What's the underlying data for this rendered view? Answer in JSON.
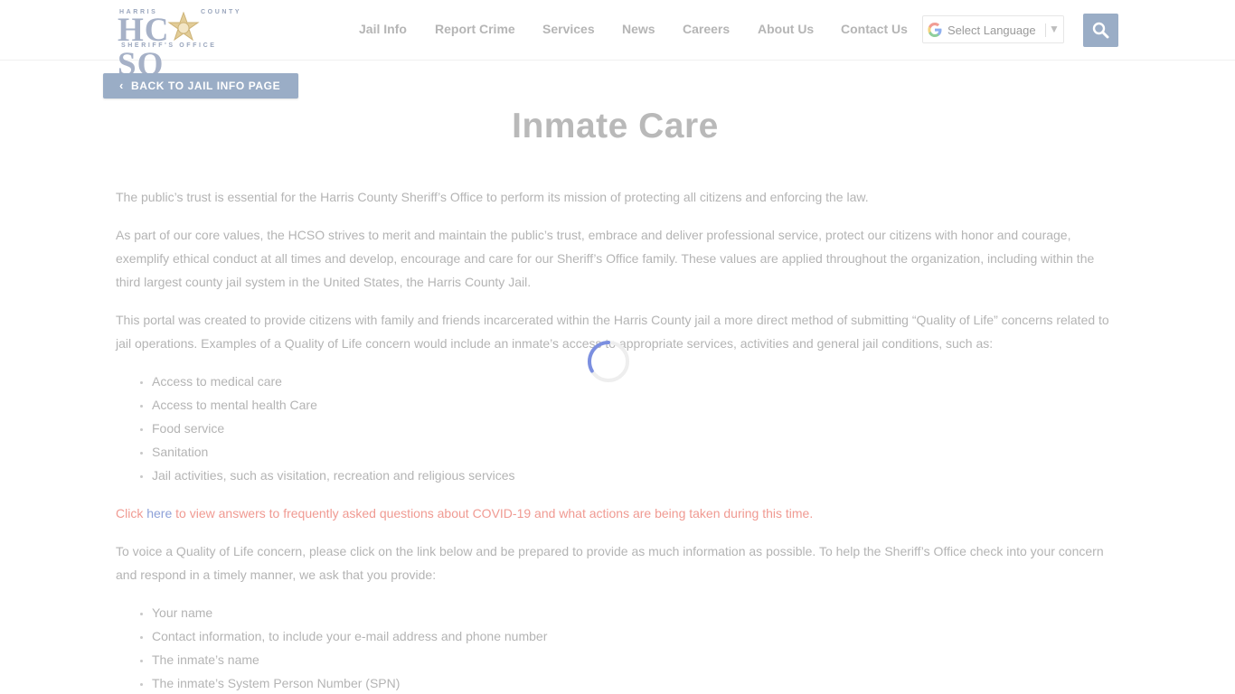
{
  "header": {
    "logo": {
      "top_left": "HARRIS",
      "top_right": "COUNTY",
      "big": "HCSO",
      "bottom": "SHERIFF'S OFFICE",
      "icon": "sheriff-star-badge"
    },
    "nav": [
      {
        "label": "Jail Info"
      },
      {
        "label": "Report Crime"
      },
      {
        "label": "Services"
      },
      {
        "label": "News"
      },
      {
        "label": "Careers"
      },
      {
        "label": "About Us"
      },
      {
        "label": "Contact Us"
      }
    ],
    "language": {
      "label": "Select Language",
      "icon": "google-g-icon"
    },
    "search": {
      "icon": "search-icon"
    }
  },
  "back_button": {
    "label": "BACK TO JAIL INFO PAGE",
    "icon": "chevron-left-icon"
  },
  "page_title": "Inmate Care",
  "content": {
    "p1": "The public’s trust is essential for the Harris County Sheriff’s Office to perform its mission of protecting all citizens and enforcing the law.",
    "p2": "As part of our core values, the HCSO strives to merit and maintain the public’s trust, embrace and deliver professional service, protect our citizens with honor and courage, exemplify ethical conduct at all times and develop, encourage and care for our Sheriff’s Office family. These values are applied throughout the organization, including within the third largest county jail system in the United States, the Harris County Jail.",
    "p3": "This portal was created to provide citizens with family and friends incarcerated within the Harris County jail a more direct method of submitting “Quality of Life” concerns related to jail operations. Examples of a Quality of Life concern would include an inmate’s access to appropriate services, activities and general jail conditions, such as:",
    "list1": [
      "Access to medical care",
      "Access to mental health Care",
      "Food service",
      "Sanitation",
      "Jail activities, such as visitation, recreation and religious services"
    ],
    "covid": {
      "prefix": "Click ",
      "link": "here",
      "suffix": " to view answers to frequently asked questions about COVID-19 and what actions are being taken during this time."
    },
    "p4": "To voice a Quality of Life concern, please click on the link below and be prepared to provide as much information as possible. To help the Sheriff’s Office check into your concern and respond in a timely manner, we ask that you provide:",
    "list2": [
      "Your name",
      "Contact information, to include your e-mail address and phone number",
      "The inmate’s name",
      "The inmate’s System Person Number (SPN)"
    ]
  },
  "colors": {
    "accent": "#9aadc6",
    "text": "#b4b4b4",
    "alert": "#f09a92",
    "link": "#8ea1d8",
    "spinner": "#7b8fe0"
  }
}
